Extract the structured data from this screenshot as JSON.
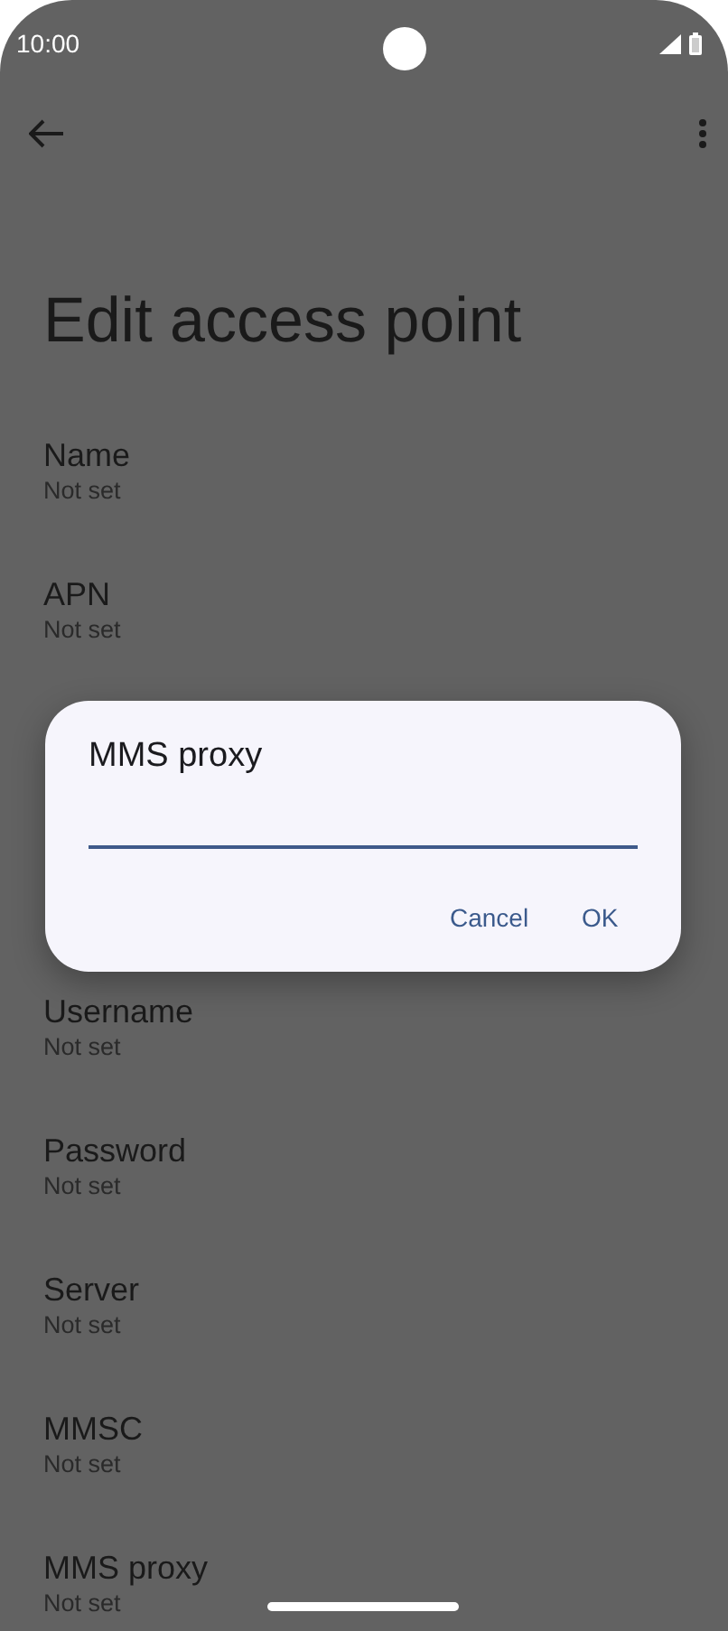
{
  "status_bar": {
    "time": "10:00"
  },
  "title": "Edit access point",
  "settings": [
    {
      "label": "Name",
      "value": "Not set"
    },
    {
      "label": "APN",
      "value": "Not set"
    },
    {
      "label": "Username",
      "value": "Not set"
    },
    {
      "label": "Password",
      "value": "Not set"
    },
    {
      "label": "Server",
      "value": "Not set"
    },
    {
      "label": "MMSC",
      "value": "Not set"
    },
    {
      "label": "MMS proxy",
      "value": "Not set"
    }
  ],
  "dialog": {
    "title": "MMS proxy",
    "buttons": [
      "Cancel",
      "OK"
    ]
  }
}
